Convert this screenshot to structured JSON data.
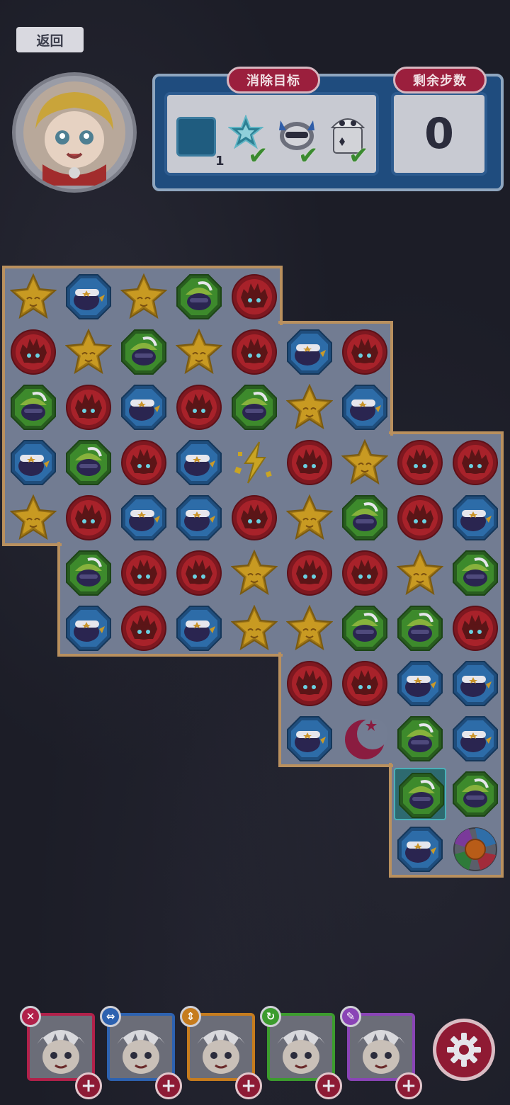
{
  "header": {
    "back_label": "返回"
  },
  "goal_panel": {
    "goal_title": "消除目标",
    "moves_title": "剩余步数",
    "moves_remaining": "0",
    "tile_goal_count": "1",
    "goals": [
      {
        "icon": "star-crystal-icon",
        "done": true
      },
      {
        "icon": "robot-helmet-icon",
        "done": true
      },
      {
        "icon": "ghost-box-icon",
        "done": true
      }
    ]
  },
  "colors": {
    "red": "#a8222a",
    "blue": "#2d6ca8",
    "green": "#3d8a2c",
    "yellow": "#c89a22",
    "board_border": "#b9905e",
    "board_fill": "#727c92"
  },
  "board": {
    "rows": [
      [
        "yellow",
        "blue",
        "yellow",
        "green",
        "red",
        null,
        null,
        null,
        null
      ],
      [
        "red",
        "yellow",
        "green",
        "yellow",
        "red",
        "blue",
        "red",
        null,
        null
      ],
      [
        "green",
        "red",
        "blue",
        "red",
        "green",
        "yellow",
        "blue",
        null,
        null
      ],
      [
        "blue",
        "green",
        "red",
        "blue",
        "lightning",
        "red",
        "yellow",
        "red",
        "red"
      ],
      [
        "yellow",
        "red",
        "blue",
        "blue",
        "red",
        "yellow",
        "green",
        "red",
        "blue"
      ],
      [
        null,
        "green",
        "red",
        "red",
        "yellow",
        "red",
        "red",
        "yellow",
        "green"
      ],
      [
        null,
        "blue",
        "red",
        "blue",
        "yellow",
        "yellow",
        "green",
        "green",
        "red"
      ],
      [
        null,
        null,
        null,
        null,
        null,
        "red",
        "red",
        "blue",
        "blue"
      ],
      [
        null,
        null,
        null,
        null,
        null,
        "blue",
        "moon",
        "green",
        "blue"
      ],
      [
        null,
        null,
        null,
        null,
        null,
        null,
        null,
        "green",
        "green"
      ],
      [
        null,
        null,
        null,
        null,
        null,
        null,
        null,
        "blue",
        "bomb"
      ]
    ],
    "highlight_cell": [
      9,
      7
    ]
  },
  "characters": [
    {
      "name": "character-1",
      "badge_icon": "close-icon",
      "border": "#b1214a",
      "badge_bg": "#b1214a"
    },
    {
      "name": "character-2",
      "badge_icon": "swap-horizontal-icon",
      "border": "#2d62b0",
      "badge_bg": "#2d62b0"
    },
    {
      "name": "character-3",
      "badge_icon": "swap-vertical-icon",
      "border": "#c67c1e",
      "badge_bg": "#c67c1e"
    },
    {
      "name": "character-4",
      "badge_icon": "refresh-icon",
      "border": "#3c9c2e",
      "badge_bg": "#3c9c2e"
    },
    {
      "name": "character-5",
      "badge_icon": "feather-icon",
      "border": "#8a44b6",
      "badge_bg": "#8a44b6"
    }
  ]
}
